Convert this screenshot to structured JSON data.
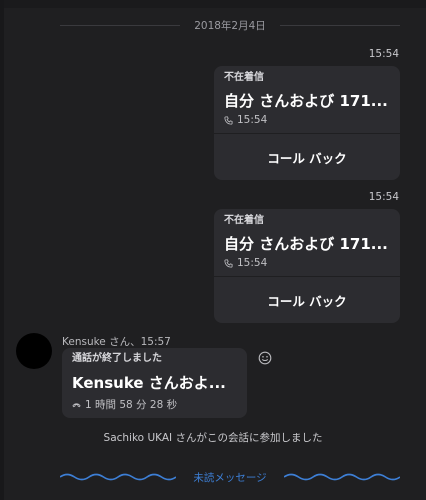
{
  "date_divider": "2018年2月4日",
  "missed_calls": [
    {
      "time": "15:54",
      "label": "不在着信",
      "title": "自分 さんおよび 171...",
      "sub_time": "15:54",
      "callback_label": "コール バック"
    },
    {
      "time": "15:54",
      "label": "不在着信",
      "title": "自分 さんおよび 171...",
      "sub_time": "15:54",
      "callback_label": "コール バック"
    }
  ],
  "incoming": {
    "sender_line": "Kensuke さん、15:57",
    "label": "通話が終了しました",
    "title": "Kensuke さんおよ...",
    "duration": "1 時間 58 分 28 秒"
  },
  "system_message": "Sachiko UKAI さんがこの会話に参加しました",
  "unread_label": "未読メッセージ",
  "colors": {
    "background": "#1f1f21",
    "card": "#2c2c30",
    "accent": "#3d7fd6"
  },
  "icons": [
    "phone-icon",
    "phone-hangup-icon",
    "emoji-icon"
  ]
}
